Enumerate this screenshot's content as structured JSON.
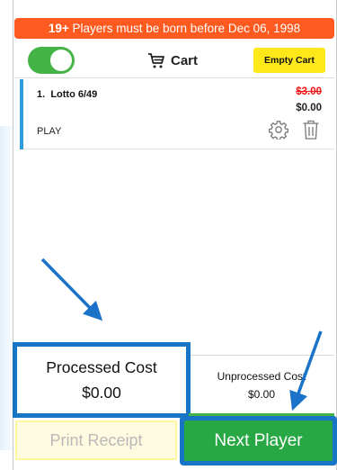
{
  "banner": {
    "age": "19+",
    "text": "Players must be born before Dec 06, 1998"
  },
  "header": {
    "toggle_on": true,
    "cart_label": "Cart",
    "empty_cart_label": "Empty Cart"
  },
  "cart": {
    "items": [
      {
        "index": "1.",
        "name": "Lotto 6/49",
        "original_price": "$3.00",
        "price": "$0.00",
        "mode": "PLAY"
      }
    ]
  },
  "totals": {
    "processed_label": "Processed Cost",
    "processed_value": "$0.00",
    "unprocessed_label": "Unprocessed Cost",
    "unprocessed_value": "$0.00"
  },
  "actions": {
    "print_receipt_label": "Print Receipt",
    "next_player_label": "Next Player"
  },
  "colors": {
    "banner": "#ff5a1f",
    "toggle_on": "#44b447",
    "empty_cart": "#ffe81a",
    "item_accent": "#2b9de0",
    "strikethrough": "#e11111",
    "highlight": "#1875c6",
    "next_player": "#27a844"
  },
  "icons": {
    "cart": "cart-icon",
    "settings": "gear-icon",
    "delete": "trash-icon"
  }
}
